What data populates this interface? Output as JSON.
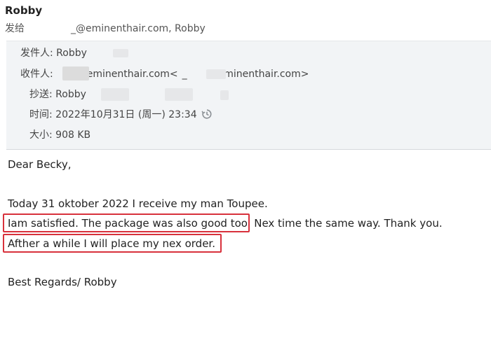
{
  "sender_name": "Robby",
  "to_line": {
    "prefix": "发给",
    "suffix": "_@eminenthair.com, Robby"
  },
  "headers": {
    "from": {
      "label": "发件人:",
      "value": "Robby"
    },
    "to": {
      "label": "收件人:",
      "value1": "@eminenthair.com<",
      "sep": "_",
      "value2": "@eminenthair.com>"
    },
    "cc": {
      "label": "抄送:",
      "value": "Robby"
    },
    "time": {
      "label": "时间:",
      "value": "2022年10月31日 (周一) 23:34"
    },
    "size": {
      "label": "大小:",
      "value": "908 KB"
    },
    "history_icon": "clock-history-icon"
  },
  "message": {
    "greeting": "Dear Becky,",
    "line1": "Today 31 oktober 2022 I receive my man Toupee.",
    "line2_highlight": "Iam satisfied. The package was also good too.",
    "line2_rest": "Nex time the same way. Thank you.",
    "line3_highlight": "Afther a while I will place my nex order.",
    "signoff": "Best Regards/ Robby"
  },
  "colors": {
    "highlight_border": "#d8313c",
    "panel_background": "#f2f4f6"
  }
}
